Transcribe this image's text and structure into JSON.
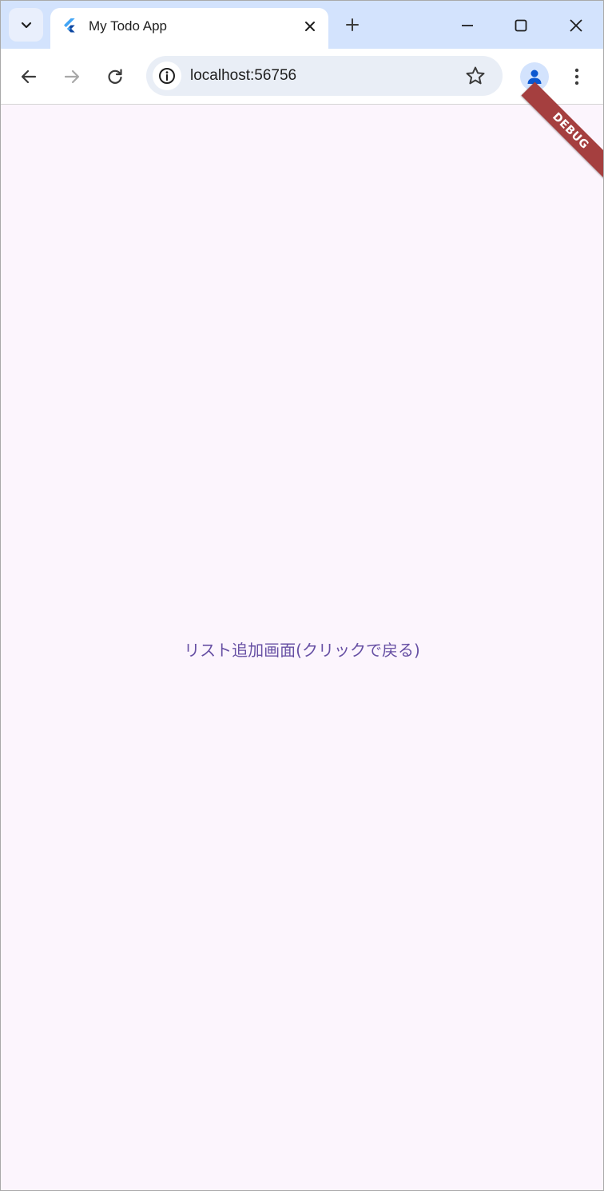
{
  "browser": {
    "tab": {
      "title": "My Todo App",
      "favicon": "flutter-logo-icon"
    },
    "address_bar": {
      "url": "localhost:56756"
    },
    "colors": {
      "tabstrip": "#d3e3fd",
      "toolbar": "#ffffff",
      "omnibox": "#e9eef6"
    }
  },
  "app": {
    "background": "#fcf5fd",
    "back_link_label": "リスト追加画面(クリックで戻る)",
    "accent": "#6750a4",
    "debug_banner_label": "DEBUG",
    "debug_banner_color": "#a53f3f"
  }
}
